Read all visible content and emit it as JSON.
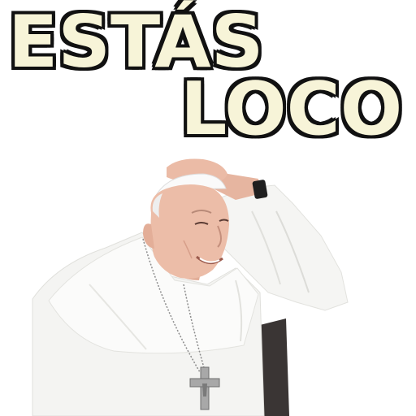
{
  "caption": {
    "line1": "ESTÁS",
    "line2": "LOCO"
  },
  "colors": {
    "text_fill": "#f7f4d8",
    "text_outline": "#111111",
    "cassock": "#f4f4f2",
    "skin": "#e9b9a3",
    "background": "#ffffff"
  },
  "icons": [
    "pectoral-cross-icon",
    "wristwatch-icon"
  ]
}
